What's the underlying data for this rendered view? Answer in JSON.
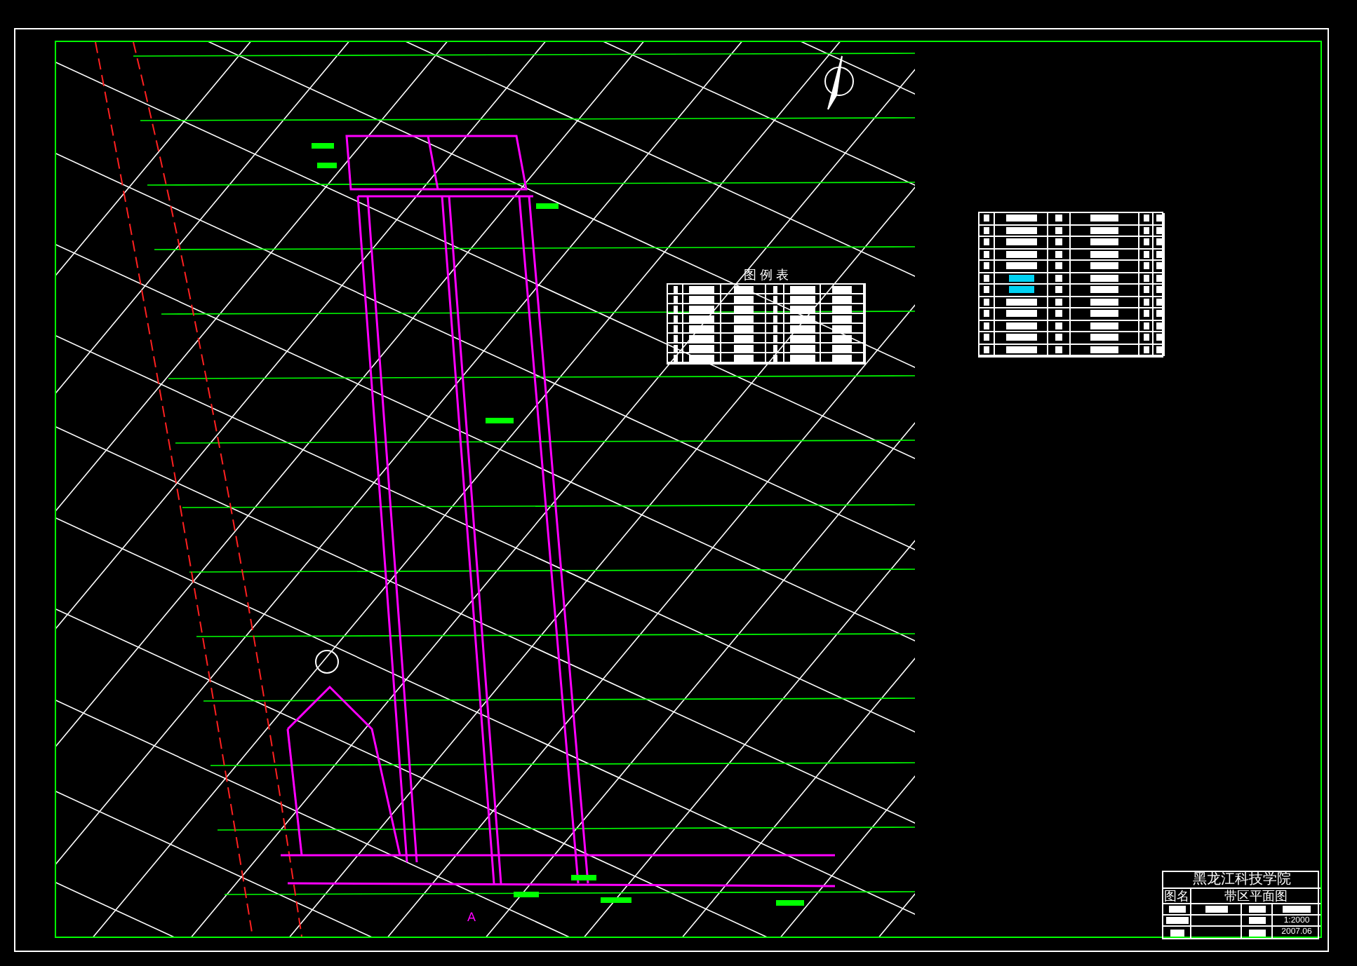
{
  "legend_table": {
    "title": "图 例 表"
  },
  "section_marker": {
    "label": "A"
  },
  "title_block": {
    "school": "黑龙江科技学院",
    "name_label": "图名",
    "drawing_name": "带区平面图",
    "scale": "1:2000",
    "date": "2007.06"
  }
}
